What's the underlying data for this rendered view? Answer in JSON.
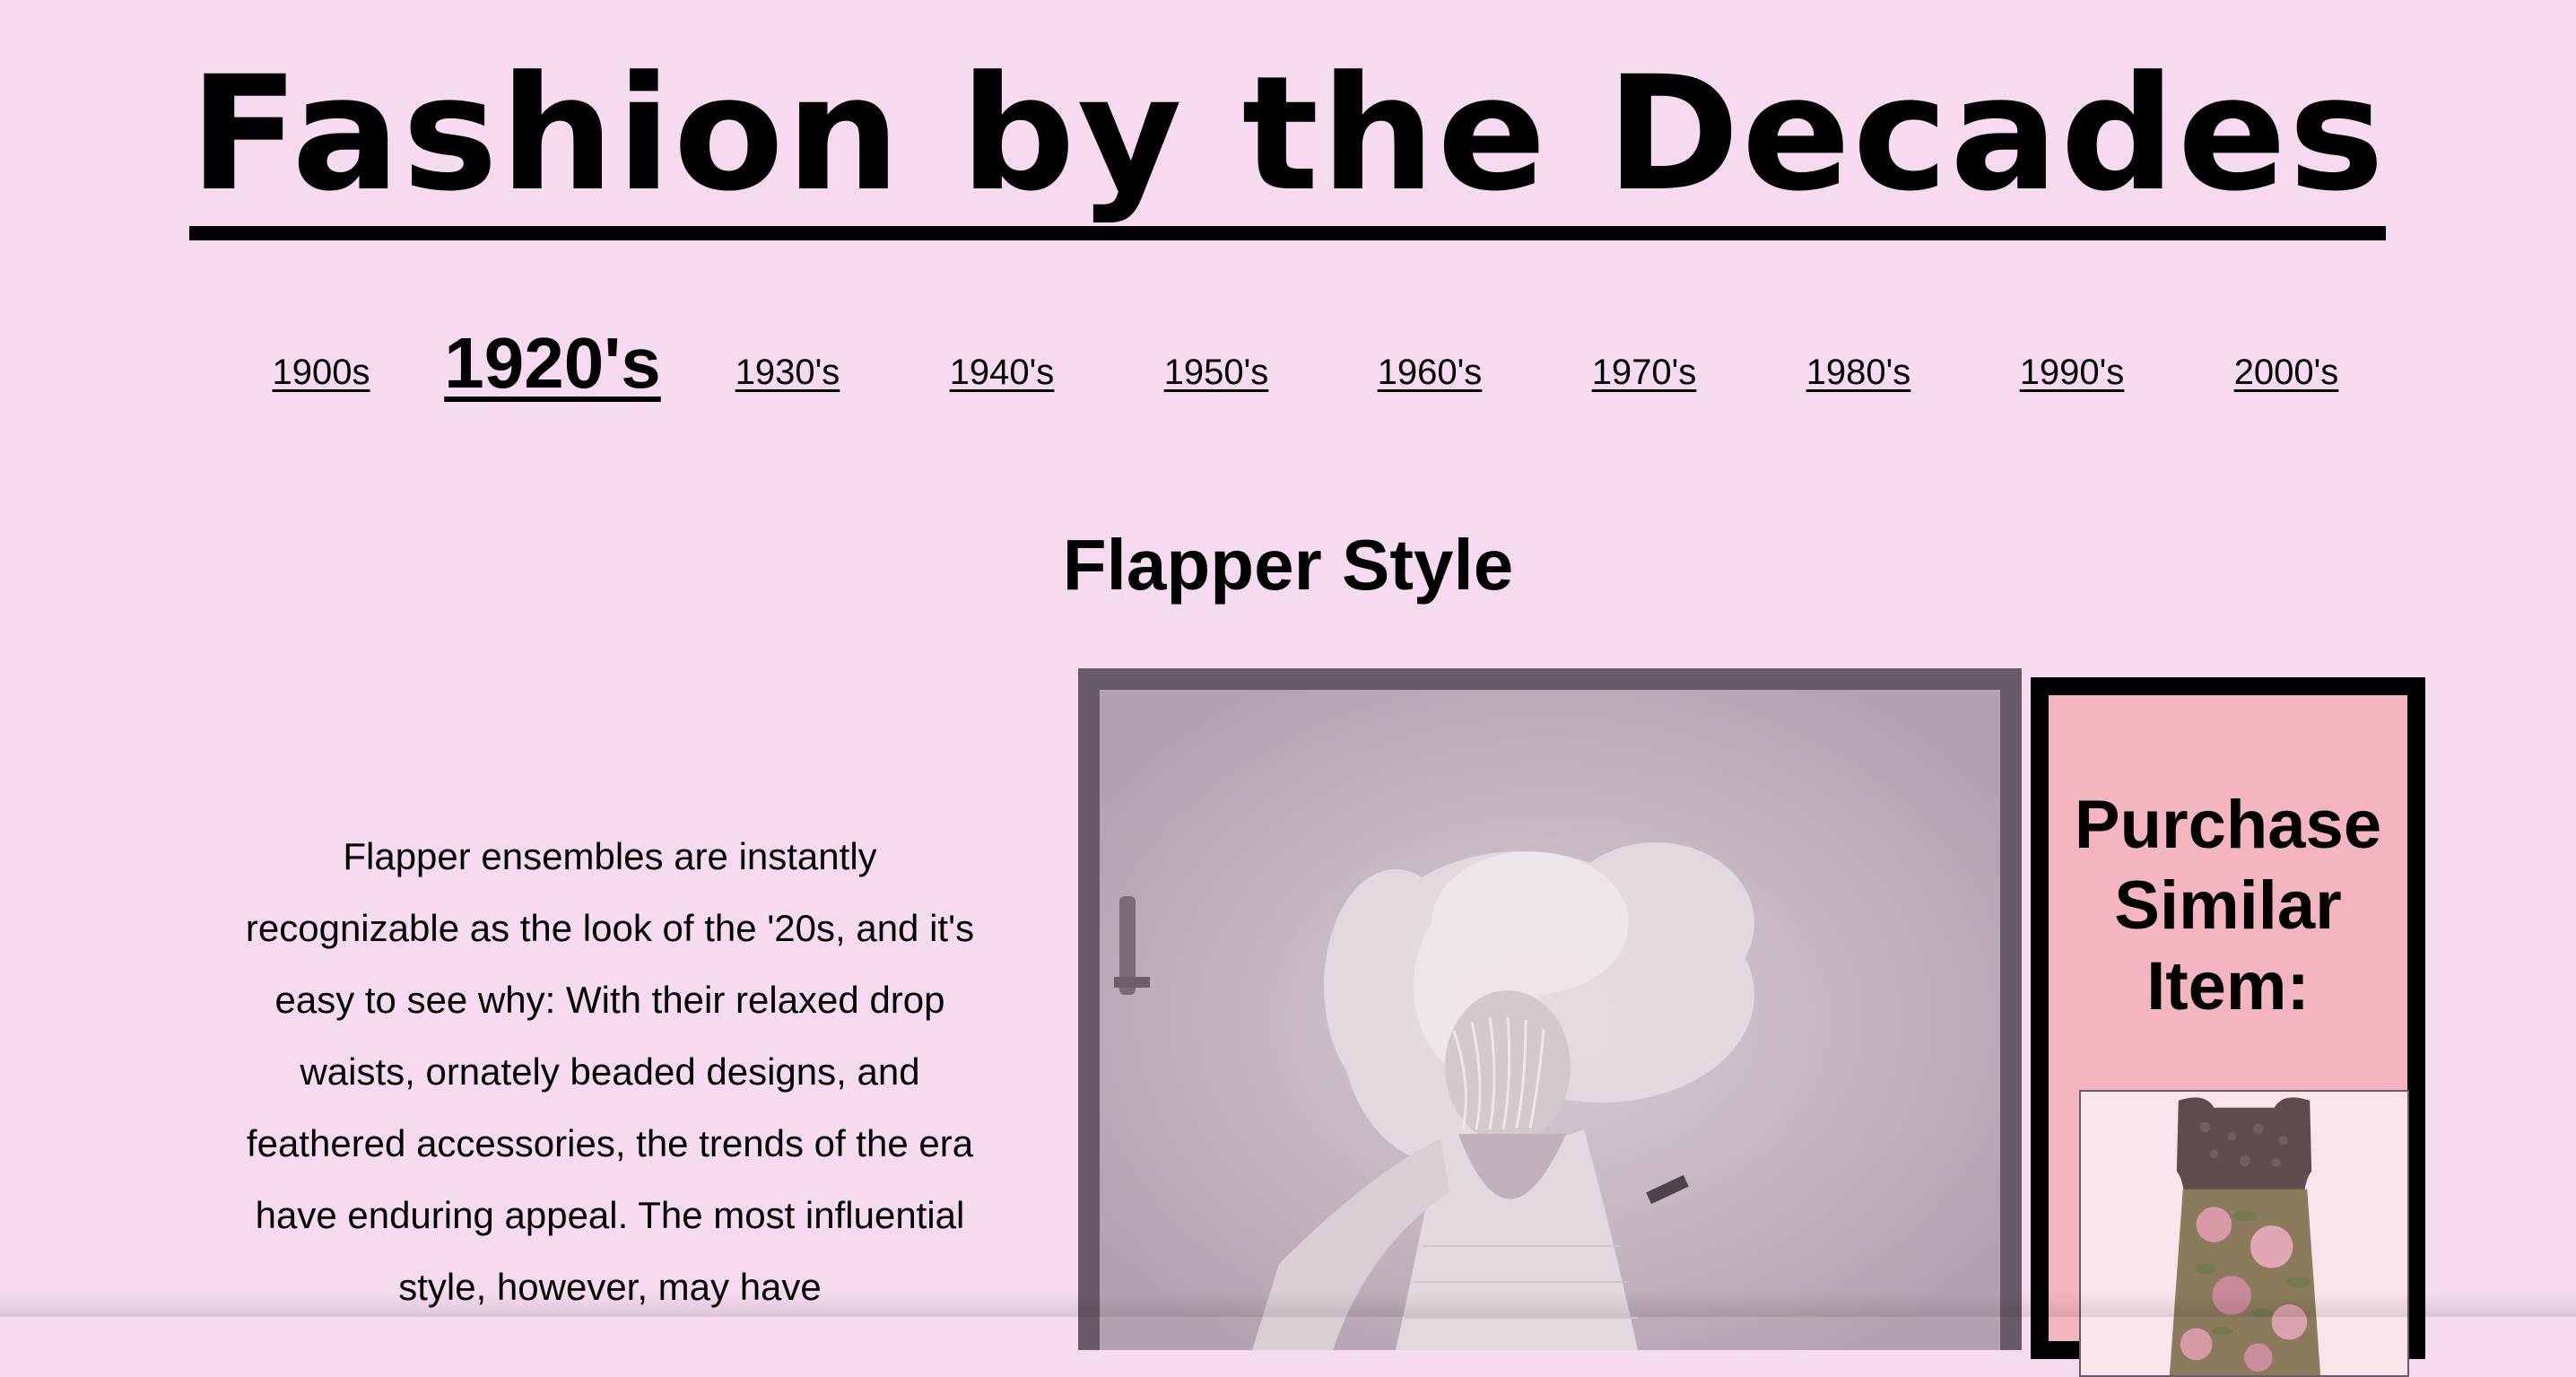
{
  "site": {
    "title": "Fashion by the Decades"
  },
  "nav": {
    "items": [
      {
        "label": "1900s",
        "active": false
      },
      {
        "label": "1920's",
        "active": true
      },
      {
        "label": "1930's",
        "active": false
      },
      {
        "label": "1940's",
        "active": false
      },
      {
        "label": "1950's",
        "active": false
      },
      {
        "label": "1960's",
        "active": false
      },
      {
        "label": "1970's",
        "active": false
      },
      {
        "label": "1980's",
        "active": false
      },
      {
        "label": "1990's",
        "active": false
      },
      {
        "label": "2000's",
        "active": false
      }
    ]
  },
  "main": {
    "heading": "Flapper Style",
    "description": "Flapper ensembles are instantly recognizable as the look of the '20s, and it's easy to see why: With their relaxed drop waists, ornately beaded designs, and feathered accessories, the trends of the era have enduring appeal. The most influential style, however, may have"
  },
  "purchase": {
    "title": "Purchase Similar Item:"
  },
  "colors": {
    "background": "#f6dbf0",
    "photo_frame": "#685a66",
    "purchase_panel": "#f3b6c0",
    "text": "#000000"
  }
}
